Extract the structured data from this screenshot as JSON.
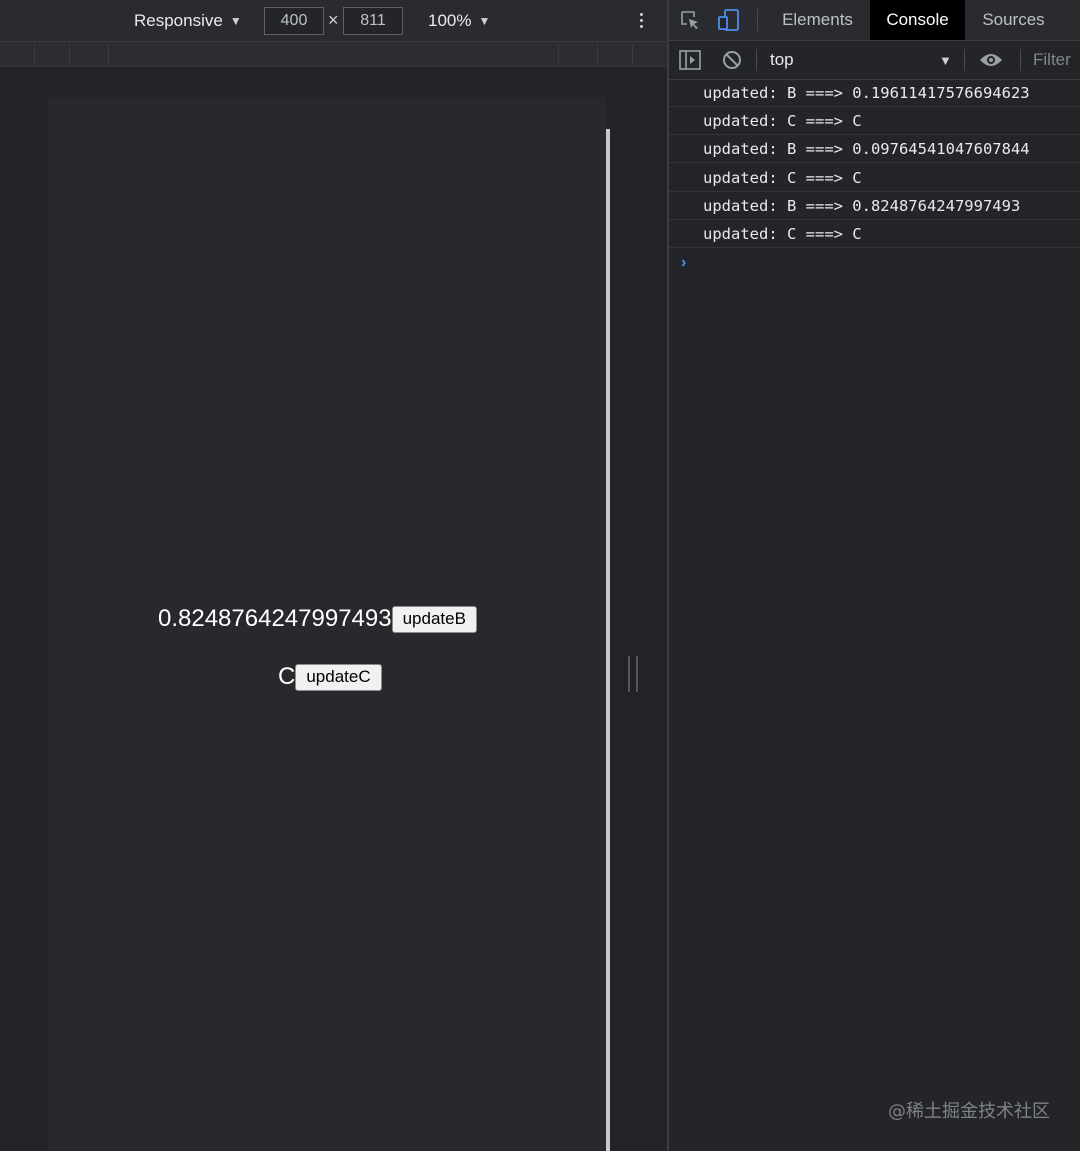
{
  "device_toolbar": {
    "device": "Responsive",
    "width": "400",
    "times": "×",
    "height": "811",
    "zoom": "100%"
  },
  "page": {
    "b_value": "0.8248764247997493",
    "b_button": "updateB",
    "c_value": "C",
    "c_button": "updateC"
  },
  "devtools": {
    "tabs": [
      "Elements",
      "Console",
      "Sources"
    ],
    "active_tab": "Console",
    "context": "top",
    "filter_placeholder": "Filter",
    "logs": [
      "updated: B ===> 0.19611417576694623",
      "updated: C ===> C",
      "updated: B ===> 0.09764541047607844",
      "updated: C ===> C",
      "updated: B ===> 0.8248764247997493",
      "updated: C ===> C"
    ],
    "prompt": "›",
    "accent_color": "#4d8ff5"
  },
  "watermark": "@稀土掘金技术社区"
}
